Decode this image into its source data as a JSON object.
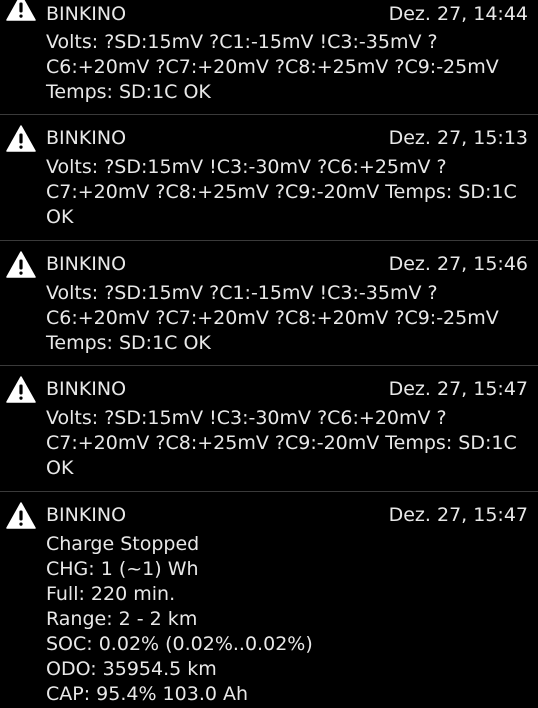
{
  "notifications": [
    {
      "icon": "warning-icon",
      "sender": "BINKINO",
      "time": "Dez. 27, 14:44",
      "lines": [
        "Volts: ?SD:15mV ?C1:-15mV !C3:-35mV ?",
        "C6:+20mV ?C7:+20mV ?C8:+25mV ?C9:-25mV",
        "Temps: SD:1C OK"
      ]
    },
    {
      "icon": "warning-icon",
      "sender": "BINKINO",
      "time": "Dez. 27, 15:13",
      "lines": [
        "Volts: ?SD:15mV !C3:-30mV ?C6:+25mV ?",
        "C7:+20mV ?C8:+25mV ?C9:-20mV Temps: SD:1C",
        "OK"
      ]
    },
    {
      "icon": "warning-icon",
      "sender": "BINKINO",
      "time": "Dez. 27, 15:46",
      "lines": [
        "Volts: ?SD:15mV ?C1:-15mV !C3:-35mV ?",
        "C6:+20mV ?C7:+20mV ?C8:+20mV ?C9:-25mV",
        "Temps: SD:1C OK"
      ]
    },
    {
      "icon": "warning-icon",
      "sender": "BINKINO",
      "time": "Dez. 27, 15:47",
      "lines": [
        "Volts: ?SD:15mV !C3:-30mV ?C6:+20mV ?",
        "C7:+20mV ?C8:+25mV ?C9:-20mV Temps: SD:1C",
        "OK"
      ]
    },
    {
      "icon": "warning-icon",
      "sender": "BINKINO",
      "time": "Dez. 27, 15:47",
      "lines": [
        "Charge Stopped",
        "CHG: 1 (~1) Wh",
        "Full: 220 min.",
        "Range: 2 - 2 km",
        "SOC: 0.02% (0.02%..0.02%)",
        "ODO: 35954.5 km",
        "CAP: 95.4% 103.0 Ah"
      ]
    }
  ],
  "colors": {
    "background": "#000000",
    "text": "#e8e8e8",
    "divider": "#3a3a3a",
    "icon": "#ffffff"
  }
}
